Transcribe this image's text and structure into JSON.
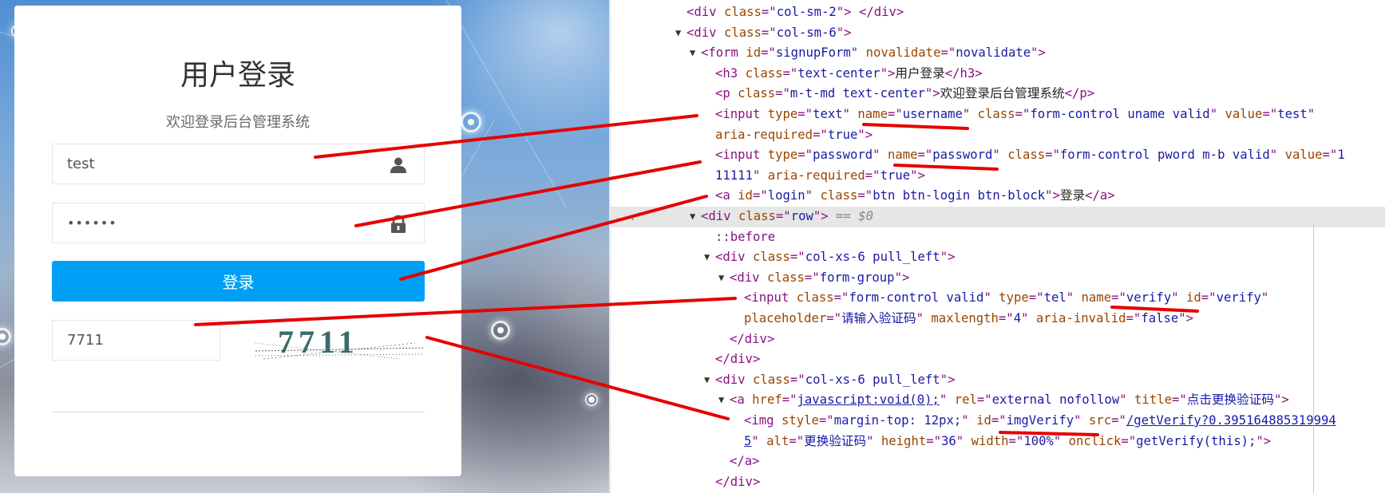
{
  "login": {
    "title": "用户登录",
    "subtitle": "欢迎登录后台管理系统",
    "username_value": "test",
    "password_mask": "••••••",
    "login_button": "登录",
    "verify_value": "7711",
    "captcha_text": "7711",
    "icons": {
      "username": "user-icon",
      "password": "lock-icon"
    }
  },
  "devtools": {
    "lines": [
      {
        "tri": "",
        "html": [
          [
            "t",
            "<div "
          ],
          [
            "an",
            "class"
          ],
          [
            "t",
            "=\""
          ],
          [
            "av",
            "col-sm-2"
          ],
          [
            "t",
            "\"> </div>"
          ]
        ]
      },
      {
        "tri": "▼",
        "html": [
          [
            "t",
            "<div "
          ],
          [
            "an",
            "class"
          ],
          [
            "t",
            "=\""
          ],
          [
            "av",
            "col-sm-6"
          ],
          [
            "t",
            "\">"
          ]
        ]
      },
      {
        "tri": "▼",
        "html": [
          [
            "t",
            "<form "
          ],
          [
            "an",
            "id"
          ],
          [
            "t",
            "=\""
          ],
          [
            "av",
            "signupForm"
          ],
          [
            "t",
            "\" "
          ],
          [
            "an",
            "novalidate"
          ],
          [
            "t",
            "=\""
          ],
          [
            "av",
            "novalidate"
          ],
          [
            "t",
            "\">"
          ]
        ]
      },
      {
        "tri": "",
        "html": [
          [
            "t",
            "<h3 "
          ],
          [
            "an",
            "class"
          ],
          [
            "t",
            "=\""
          ],
          [
            "av",
            "text-center"
          ],
          [
            "t",
            "\">"
          ],
          [
            "tx",
            "用户登录"
          ],
          [
            "t",
            "</h3>"
          ]
        ]
      },
      {
        "tri": "",
        "html": [
          [
            "t",
            "<p "
          ],
          [
            "an",
            "class"
          ],
          [
            "t",
            "=\""
          ],
          [
            "av",
            "m-t-md text-center"
          ],
          [
            "t",
            "\">"
          ],
          [
            "tx",
            "欢迎登录后台管理系统"
          ],
          [
            "t",
            "</p>"
          ]
        ]
      },
      {
        "tri": "",
        "html": [
          [
            "t",
            "<input "
          ],
          [
            "an",
            "type"
          ],
          [
            "t",
            "=\""
          ],
          [
            "av",
            "text"
          ],
          [
            "t",
            "\" "
          ],
          [
            "an",
            "name"
          ],
          [
            "t",
            "=\""
          ],
          [
            "av",
            "username"
          ],
          [
            "t",
            "\" "
          ],
          [
            "an",
            "class"
          ],
          [
            "t",
            "=\""
          ],
          [
            "av",
            "form-control uname valid"
          ],
          [
            "t",
            "\" "
          ],
          [
            "an",
            "value"
          ],
          [
            "t",
            "=\""
          ],
          [
            "av",
            "test"
          ],
          [
            "t",
            "\""
          ]
        ]
      },
      {
        "tri": "",
        "html": [
          [
            "an",
            "aria-required"
          ],
          [
            "t",
            "=\""
          ],
          [
            "av",
            "true"
          ],
          [
            "t",
            "\">"
          ]
        ]
      },
      {
        "tri": "",
        "html": [
          [
            "t",
            "<input "
          ],
          [
            "an",
            "type"
          ],
          [
            "t",
            "=\""
          ],
          [
            "av",
            "password"
          ],
          [
            "t",
            "\" "
          ],
          [
            "an",
            "name"
          ],
          [
            "t",
            "=\""
          ],
          [
            "av",
            "password"
          ],
          [
            "t",
            "\" "
          ],
          [
            "an",
            "class"
          ],
          [
            "t",
            "=\""
          ],
          [
            "av",
            "form-control pword m-b valid"
          ],
          [
            "t",
            "\" "
          ],
          [
            "an",
            "value"
          ],
          [
            "t",
            "=\""
          ],
          [
            "av",
            "1"
          ]
        ]
      },
      {
        "tri": "",
        "html": [
          [
            "av",
            "11111"
          ],
          [
            "t",
            "\" "
          ],
          [
            "an",
            "aria-required"
          ],
          [
            "t",
            "=\""
          ],
          [
            "av",
            "true"
          ],
          [
            "t",
            "\">"
          ]
        ]
      },
      {
        "tri": "",
        "html": [
          [
            "t",
            "<a "
          ],
          [
            "an",
            "id"
          ],
          [
            "t",
            "=\""
          ],
          [
            "av",
            "login"
          ],
          [
            "t",
            "\" "
          ],
          [
            "an",
            "class"
          ],
          [
            "t",
            "=\""
          ],
          [
            "av",
            "btn btn-login btn-block"
          ],
          [
            "t",
            "\">"
          ],
          [
            "tx",
            "登录"
          ],
          [
            "t",
            "</a>"
          ]
        ]
      },
      {
        "tri": "▼",
        "selected": true,
        "prefix": "...",
        "html": [
          [
            "t",
            "<div "
          ],
          [
            "an",
            "class"
          ],
          [
            "t",
            "=\""
          ],
          [
            "av",
            "row"
          ],
          [
            "t",
            "\">"
          ],
          [
            "cm",
            " == $0"
          ]
        ]
      },
      {
        "tri": "",
        "html": [
          [
            "ps",
            "::before"
          ]
        ]
      },
      {
        "tri": "▼",
        "html": [
          [
            "t",
            "<div "
          ],
          [
            "an",
            "class"
          ],
          [
            "t",
            "=\""
          ],
          [
            "av",
            "col-xs-6 pull_left"
          ],
          [
            "t",
            "\">"
          ]
        ]
      },
      {
        "tri": "▼",
        "html": [
          [
            "t",
            "<div "
          ],
          [
            "an",
            "class"
          ],
          [
            "t",
            "=\""
          ],
          [
            "av",
            "form-group"
          ],
          [
            "t",
            "\">"
          ]
        ]
      },
      {
        "tri": "",
        "html": [
          [
            "t",
            "<input "
          ],
          [
            "an",
            "class"
          ],
          [
            "t",
            "=\""
          ],
          [
            "av",
            "form-control valid"
          ],
          [
            "t",
            "\" "
          ],
          [
            "an",
            "type"
          ],
          [
            "t",
            "=\""
          ],
          [
            "av",
            "tel"
          ],
          [
            "t",
            "\" "
          ],
          [
            "an",
            "name"
          ],
          [
            "t",
            "=\""
          ],
          [
            "av",
            "verify"
          ],
          [
            "t",
            "\" "
          ],
          [
            "an",
            "id"
          ],
          [
            "t",
            "=\""
          ],
          [
            "av",
            "verify"
          ],
          [
            "t",
            "\""
          ]
        ]
      },
      {
        "tri": "",
        "html": [
          [
            "an",
            "placeholder"
          ],
          [
            "t",
            "=\""
          ],
          [
            "av",
            "请输入验证码"
          ],
          [
            "t",
            "\" "
          ],
          [
            "an",
            "maxlength"
          ],
          [
            "t",
            "=\""
          ],
          [
            "av",
            "4"
          ],
          [
            "t",
            "\" "
          ],
          [
            "an",
            "aria-invalid"
          ],
          [
            "t",
            "=\""
          ],
          [
            "av",
            "false"
          ],
          [
            "t",
            "\">"
          ]
        ]
      },
      {
        "tri": "",
        "html": [
          [
            "t",
            "</div>"
          ]
        ]
      },
      {
        "tri": "",
        "html": [
          [
            "t",
            "</div>"
          ]
        ]
      },
      {
        "tri": "▼",
        "html": [
          [
            "t",
            "<div "
          ],
          [
            "an",
            "class"
          ],
          [
            "t",
            "=\""
          ],
          [
            "av",
            "col-xs-6 pull_left"
          ],
          [
            "t",
            "\">"
          ]
        ]
      },
      {
        "tri": "▼",
        "html": [
          [
            "t",
            "<a "
          ],
          [
            "an",
            "href"
          ],
          [
            "t",
            "=\""
          ],
          [
            "lk",
            "javascript:void(0);"
          ],
          [
            "t",
            "\" "
          ],
          [
            "an",
            "rel"
          ],
          [
            "t",
            "=\""
          ],
          [
            "av",
            "external nofollow"
          ],
          [
            "t",
            "\" "
          ],
          [
            "an",
            "title"
          ],
          [
            "t",
            "=\""
          ],
          [
            "av",
            "点击更换验证码"
          ],
          [
            "t",
            "\">"
          ]
        ]
      },
      {
        "tri": "",
        "html": [
          [
            "t",
            "<img "
          ],
          [
            "an",
            "style"
          ],
          [
            "t",
            "=\""
          ],
          [
            "av",
            "margin-top: 12px;"
          ],
          [
            "t",
            "\" "
          ],
          [
            "an",
            "id"
          ],
          [
            "t",
            "=\""
          ],
          [
            "av",
            "imgVerify"
          ],
          [
            "t",
            "\" "
          ],
          [
            "an",
            "src"
          ],
          [
            "t",
            "=\""
          ],
          [
            "lk",
            "/getVerify?0.395164885319994"
          ]
        ]
      },
      {
        "tri": "",
        "html": [
          [
            "lk",
            "5"
          ],
          [
            "t",
            "\" "
          ],
          [
            "an",
            "alt"
          ],
          [
            "t",
            "=\""
          ],
          [
            "av",
            "更换验证码"
          ],
          [
            "t",
            "\" "
          ],
          [
            "an",
            "height"
          ],
          [
            "t",
            "=\""
          ],
          [
            "av",
            "36"
          ],
          [
            "t",
            "\" "
          ],
          [
            "an",
            "width"
          ],
          [
            "t",
            "=\""
          ],
          [
            "av",
            "100%"
          ],
          [
            "t",
            "\" "
          ],
          [
            "an",
            "onclick"
          ],
          [
            "t",
            "=\""
          ],
          [
            "av",
            "getVerify(this);"
          ],
          [
            "t",
            "\">"
          ]
        ]
      },
      {
        "tri": "",
        "html": [
          [
            "t",
            "</a>"
          ]
        ]
      },
      {
        "tri": "",
        "html": [
          [
            "t",
            "</div>"
          ]
        ]
      }
    ]
  },
  "colors": {
    "login_button": "#009ff5",
    "annotation_red": "#e60000",
    "devtools_tag": "#881280",
    "devtools_attr_name": "#994500",
    "devtools_attr_value": "#1a1aa6"
  }
}
